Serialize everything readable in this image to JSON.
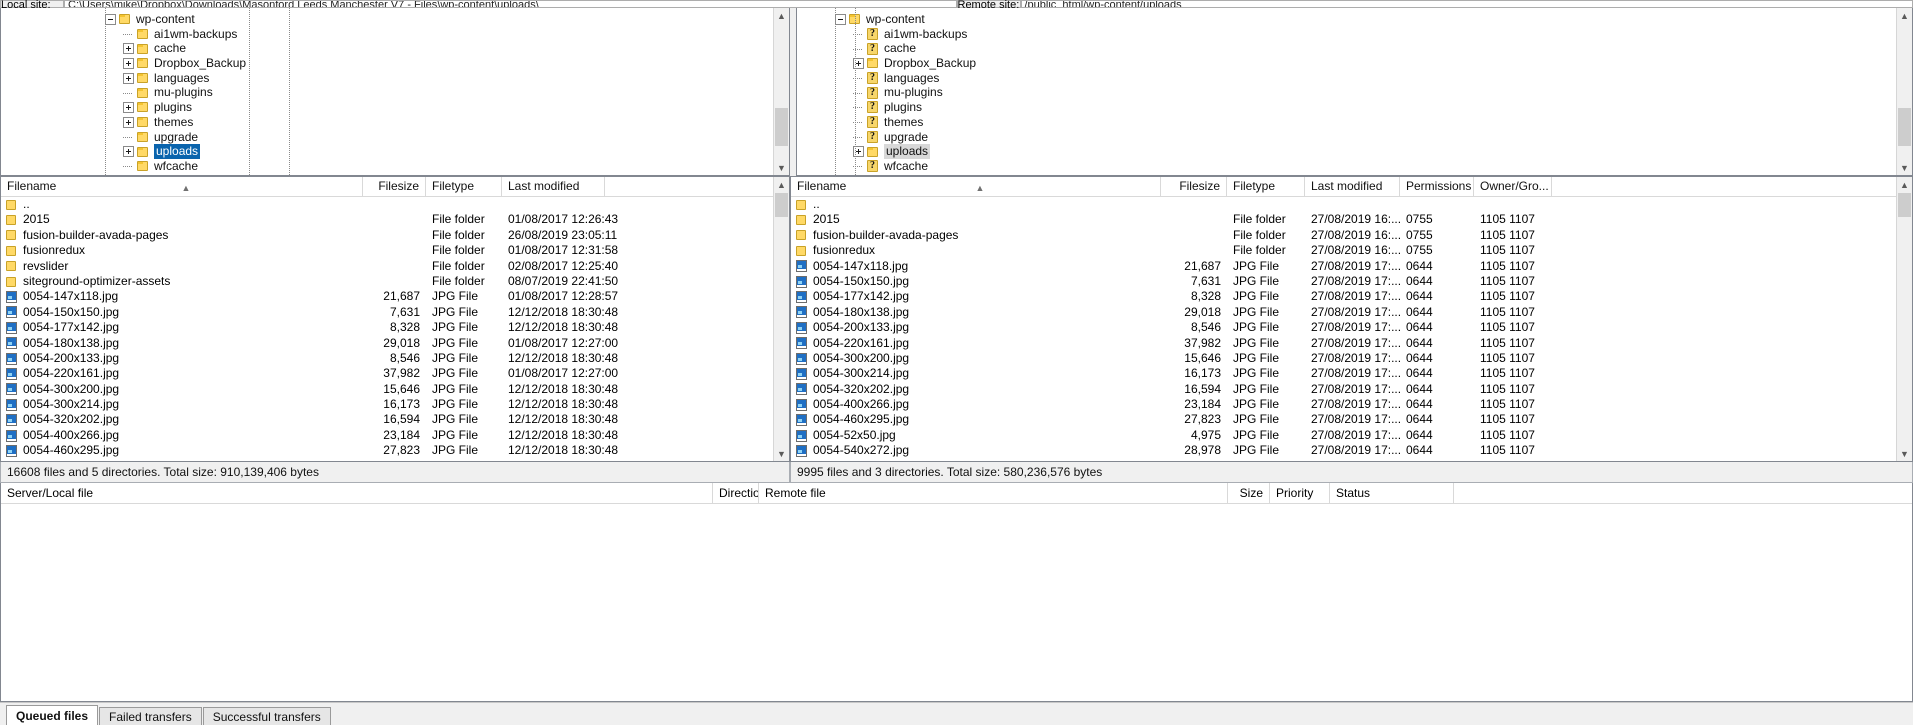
{
  "app": {
    "name": "FileZilla"
  },
  "pathbars": {
    "local": {
      "label": "Local site:",
      "value": "C:\\Users\\mike\\Dropbox\\Downloads\\Masonford Leeds Manchester V7 - Files\\wp-content\\uploads\\"
    },
    "remote": {
      "label": "Remote site:",
      "value": "/public_html/wp-content/uploads"
    }
  },
  "local_tree": {
    "nodes": [
      {
        "label": "wp-content",
        "indent": 0,
        "toggle": "minus",
        "icon": "folder",
        "selected": false
      },
      {
        "label": "ai1wm-backups",
        "indent": 1,
        "toggle": "none",
        "icon": "folder",
        "selected": false
      },
      {
        "label": "cache",
        "indent": 1,
        "toggle": "plus",
        "icon": "folder",
        "selected": false
      },
      {
        "label": "Dropbox_Backup",
        "indent": 1,
        "toggle": "plus",
        "icon": "folder",
        "selected": false
      },
      {
        "label": "languages",
        "indent": 1,
        "toggle": "plus",
        "icon": "folder",
        "selected": false
      },
      {
        "label": "mu-plugins",
        "indent": 1,
        "toggle": "none",
        "icon": "folder",
        "selected": false
      },
      {
        "label": "plugins",
        "indent": 1,
        "toggle": "plus",
        "icon": "folder",
        "selected": false
      },
      {
        "label": "themes",
        "indent": 1,
        "toggle": "plus",
        "icon": "folder",
        "selected": false
      },
      {
        "label": "upgrade",
        "indent": 1,
        "toggle": "none",
        "icon": "folder",
        "selected": false
      },
      {
        "label": "uploads",
        "indent": 1,
        "toggle": "plus",
        "icon": "folder",
        "selected": true
      },
      {
        "label": "wfcache",
        "indent": 1,
        "toggle": "none",
        "icon": "folder",
        "selected": false
      }
    ]
  },
  "remote_tree": {
    "nodes": [
      {
        "label": "wp-content",
        "indent": 0,
        "toggle": "minus",
        "icon": "folder",
        "selected": false
      },
      {
        "label": "ai1wm-backups",
        "indent": 1,
        "toggle": "none",
        "icon": "unknown",
        "selected": false
      },
      {
        "label": "cache",
        "indent": 1,
        "toggle": "none",
        "icon": "unknown",
        "selected": false
      },
      {
        "label": "Dropbox_Backup",
        "indent": 1,
        "toggle": "plus",
        "icon": "folder",
        "selected": false
      },
      {
        "label": "languages",
        "indent": 1,
        "toggle": "none",
        "icon": "unknown",
        "selected": false
      },
      {
        "label": "mu-plugins",
        "indent": 1,
        "toggle": "none",
        "icon": "unknown",
        "selected": false
      },
      {
        "label": "plugins",
        "indent": 1,
        "toggle": "none",
        "icon": "unknown",
        "selected": false
      },
      {
        "label": "themes",
        "indent": 1,
        "toggle": "none",
        "icon": "unknown",
        "selected": false
      },
      {
        "label": "upgrade",
        "indent": 1,
        "toggle": "none",
        "icon": "unknown",
        "selected": false
      },
      {
        "label": "uploads",
        "indent": 1,
        "toggle": "plus",
        "icon": "folder",
        "selected": false,
        "greyhi": true
      },
      {
        "label": "wfcache",
        "indent": 1,
        "toggle": "none",
        "icon": "unknown",
        "selected": false
      }
    ]
  },
  "local_list": {
    "columns": [
      "Filename",
      "Filesize",
      "Filetype",
      "Last modified"
    ],
    "sorted_column": "Filename",
    "sort_direction": "asc",
    "rows": [
      {
        "icon": "folder",
        "name": "..",
        "size": "",
        "type": "",
        "modified": ""
      },
      {
        "icon": "folder",
        "name": "2015",
        "size": "",
        "type": "File folder",
        "modified": "01/08/2017 12:26:43"
      },
      {
        "icon": "folder",
        "name": "fusion-builder-avada-pages",
        "size": "",
        "type": "File folder",
        "modified": "26/08/2019 23:05:11"
      },
      {
        "icon": "folder",
        "name": "fusionredux",
        "size": "",
        "type": "File folder",
        "modified": "01/08/2017 12:31:58"
      },
      {
        "icon": "folder",
        "name": "revslider",
        "size": "",
        "type": "File folder",
        "modified": "02/08/2017 12:25:40"
      },
      {
        "icon": "folder",
        "name": "siteground-optimizer-assets",
        "size": "",
        "type": "File folder",
        "modified": "08/07/2019 22:41:50"
      },
      {
        "icon": "jpg",
        "name": "0054-147x118.jpg",
        "size": "21,687",
        "type": "JPG File",
        "modified": "01/08/2017 12:28:57"
      },
      {
        "icon": "jpg",
        "name": "0054-150x150.jpg",
        "size": "7,631",
        "type": "JPG File",
        "modified": "12/12/2018 18:30:48"
      },
      {
        "icon": "jpg",
        "name": "0054-177x142.jpg",
        "size": "8,328",
        "type": "JPG File",
        "modified": "12/12/2018 18:30:48"
      },
      {
        "icon": "jpg",
        "name": "0054-180x138.jpg",
        "size": "29,018",
        "type": "JPG File",
        "modified": "01/08/2017 12:27:00"
      },
      {
        "icon": "jpg",
        "name": "0054-200x133.jpg",
        "size": "8,546",
        "type": "JPG File",
        "modified": "12/12/2018 18:30:48"
      },
      {
        "icon": "jpg",
        "name": "0054-220x161.jpg",
        "size": "37,982",
        "type": "JPG File",
        "modified": "01/08/2017 12:27:00"
      },
      {
        "icon": "jpg",
        "name": "0054-300x200.jpg",
        "size": "15,646",
        "type": "JPG File",
        "modified": "12/12/2018 18:30:48"
      },
      {
        "icon": "jpg",
        "name": "0054-300x214.jpg",
        "size": "16,173",
        "type": "JPG File",
        "modified": "12/12/2018 18:30:48"
      },
      {
        "icon": "jpg",
        "name": "0054-320x202.jpg",
        "size": "16,594",
        "type": "JPG File",
        "modified": "12/12/2018 18:30:48"
      },
      {
        "icon": "jpg",
        "name": "0054-400x266.jpg",
        "size": "23,184",
        "type": "JPG File",
        "modified": "12/12/2018 18:30:48"
      },
      {
        "icon": "jpg",
        "name": "0054-460x295.jpg",
        "size": "27,823",
        "type": "JPG File",
        "modified": "12/12/2018 18:30:48"
      }
    ],
    "status": "16608 files and 5 directories. Total size: 910,139,406 bytes"
  },
  "remote_list": {
    "columns": [
      "Filename",
      "Filesize",
      "Filetype",
      "Last modified",
      "Permissions",
      "Owner/Gro..."
    ],
    "sorted_column": "Filename",
    "sort_direction": "asc",
    "rows": [
      {
        "icon": "folder",
        "name": "..",
        "size": "",
        "type": "",
        "modified": "",
        "perms": "",
        "owner": ""
      },
      {
        "icon": "folder",
        "name": "2015",
        "size": "",
        "type": "File folder",
        "modified": "27/08/2019 16:...",
        "perms": "0755",
        "owner": "1105 1107"
      },
      {
        "icon": "folder",
        "name": "fusion-builder-avada-pages",
        "size": "",
        "type": "File folder",
        "modified": "27/08/2019 16:...",
        "perms": "0755",
        "owner": "1105 1107"
      },
      {
        "icon": "folder",
        "name": "fusionredux",
        "size": "",
        "type": "File folder",
        "modified": "27/08/2019 16:...",
        "perms": "0755",
        "owner": "1105 1107"
      },
      {
        "icon": "jpg",
        "name": "0054-147x118.jpg",
        "size": "21,687",
        "type": "JPG File",
        "modified": "27/08/2019 17:...",
        "perms": "0644",
        "owner": "1105 1107"
      },
      {
        "icon": "jpg",
        "name": "0054-150x150.jpg",
        "size": "7,631",
        "type": "JPG File",
        "modified": "27/08/2019 17:...",
        "perms": "0644",
        "owner": "1105 1107"
      },
      {
        "icon": "jpg",
        "name": "0054-177x142.jpg",
        "size": "8,328",
        "type": "JPG File",
        "modified": "27/08/2019 17:...",
        "perms": "0644",
        "owner": "1105 1107"
      },
      {
        "icon": "jpg",
        "name": "0054-180x138.jpg",
        "size": "29,018",
        "type": "JPG File",
        "modified": "27/08/2019 17:...",
        "perms": "0644",
        "owner": "1105 1107"
      },
      {
        "icon": "jpg",
        "name": "0054-200x133.jpg",
        "size": "8,546",
        "type": "JPG File",
        "modified": "27/08/2019 17:...",
        "perms": "0644",
        "owner": "1105 1107"
      },
      {
        "icon": "jpg",
        "name": "0054-220x161.jpg",
        "size": "37,982",
        "type": "JPG File",
        "modified": "27/08/2019 17:...",
        "perms": "0644",
        "owner": "1105 1107"
      },
      {
        "icon": "jpg",
        "name": "0054-300x200.jpg",
        "size": "15,646",
        "type": "JPG File",
        "modified": "27/08/2019 17:...",
        "perms": "0644",
        "owner": "1105 1107"
      },
      {
        "icon": "jpg",
        "name": "0054-300x214.jpg",
        "size": "16,173",
        "type": "JPG File",
        "modified": "27/08/2019 17:...",
        "perms": "0644",
        "owner": "1105 1107"
      },
      {
        "icon": "jpg",
        "name": "0054-320x202.jpg",
        "size": "16,594",
        "type": "JPG File",
        "modified": "27/08/2019 17:...",
        "perms": "0644",
        "owner": "1105 1107"
      },
      {
        "icon": "jpg",
        "name": "0054-400x266.jpg",
        "size": "23,184",
        "type": "JPG File",
        "modified": "27/08/2019 17:...",
        "perms": "0644",
        "owner": "1105 1107"
      },
      {
        "icon": "jpg",
        "name": "0054-460x295.jpg",
        "size": "27,823",
        "type": "JPG File",
        "modified": "27/08/2019 17:...",
        "perms": "0644",
        "owner": "1105 1107"
      },
      {
        "icon": "jpg",
        "name": "0054-52x50.jpg",
        "size": "4,975",
        "type": "JPG File",
        "modified": "27/08/2019 17:...",
        "perms": "0644",
        "owner": "1105 1107"
      },
      {
        "icon": "jpg",
        "name": "0054-540x272.jpg",
        "size": "28,978",
        "type": "JPG File",
        "modified": "27/08/2019 17:...",
        "perms": "0644",
        "owner": "1105 1107"
      }
    ],
    "status": "9995 files and 3 directories. Total size: 580,236,576 bytes"
  },
  "queue": {
    "columns": [
      "Server/Local file",
      "Direction",
      "Remote file",
      "Size",
      "Priority",
      "Status"
    ],
    "rows": []
  },
  "bottom_tabs": [
    {
      "label": "Queued files",
      "active": true
    },
    {
      "label": "Failed transfers",
      "active": false
    },
    {
      "label": "Successful transfers",
      "active": false
    }
  ],
  "colors": {
    "selection": "#0a64ad",
    "folder": "#ffd966",
    "panel": "#f0f0f0"
  }
}
